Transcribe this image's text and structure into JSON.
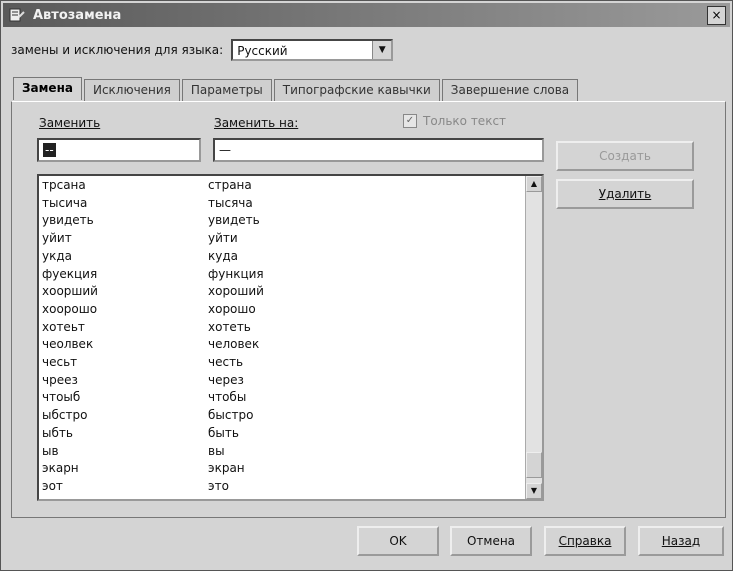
{
  "window": {
    "title": "Автозамена",
    "close_glyph": "×"
  },
  "language": {
    "label": "замены и исключения для языка:",
    "value": "Русский"
  },
  "tabs": [
    {
      "label": "Замена"
    },
    {
      "label": "Исключения"
    },
    {
      "label": "Параметры"
    },
    {
      "label": "Типографские кавычки"
    },
    {
      "label": "Завершение слова"
    }
  ],
  "form": {
    "replace_label": "Заменить",
    "replace_with_label": "Заменить на:",
    "replace_value": "--",
    "replace_with_value": "—",
    "text_only_label": "Только текст",
    "create_button": "Создать",
    "delete_button": "Удалить"
  },
  "entries": [
    [
      "трсана",
      "страна"
    ],
    [
      "тысича",
      "тысяча"
    ],
    [
      "увидеть",
      "увидеть"
    ],
    [
      "уйит",
      "уйти"
    ],
    [
      "укда",
      "куда"
    ],
    [
      "фуекция",
      "функция"
    ],
    [
      "хоорший",
      "хороший"
    ],
    [
      "хоорошо",
      "хорошо"
    ],
    [
      "хотеьт",
      "хотеть"
    ],
    [
      "чеолвек",
      "человек"
    ],
    [
      "чесьт",
      "честь"
    ],
    [
      "чреез",
      "через"
    ],
    [
      "чтоыб",
      "чтобы"
    ],
    [
      "ыбстро",
      "быстро"
    ],
    [
      "ыбть",
      "быть"
    ],
    [
      "ыв",
      "вы"
    ],
    [
      "экарн",
      "экран"
    ],
    [
      "эот",
      "это"
    ]
  ],
  "footer": {
    "ok": "OK",
    "cancel": "Отмена",
    "help": "Справка",
    "back": "Назад"
  },
  "icons": {
    "app": "autocorrect-icon",
    "scroll_up": "▲",
    "scroll_down": "▼",
    "dropdown": "▼",
    "check": "✓"
  }
}
